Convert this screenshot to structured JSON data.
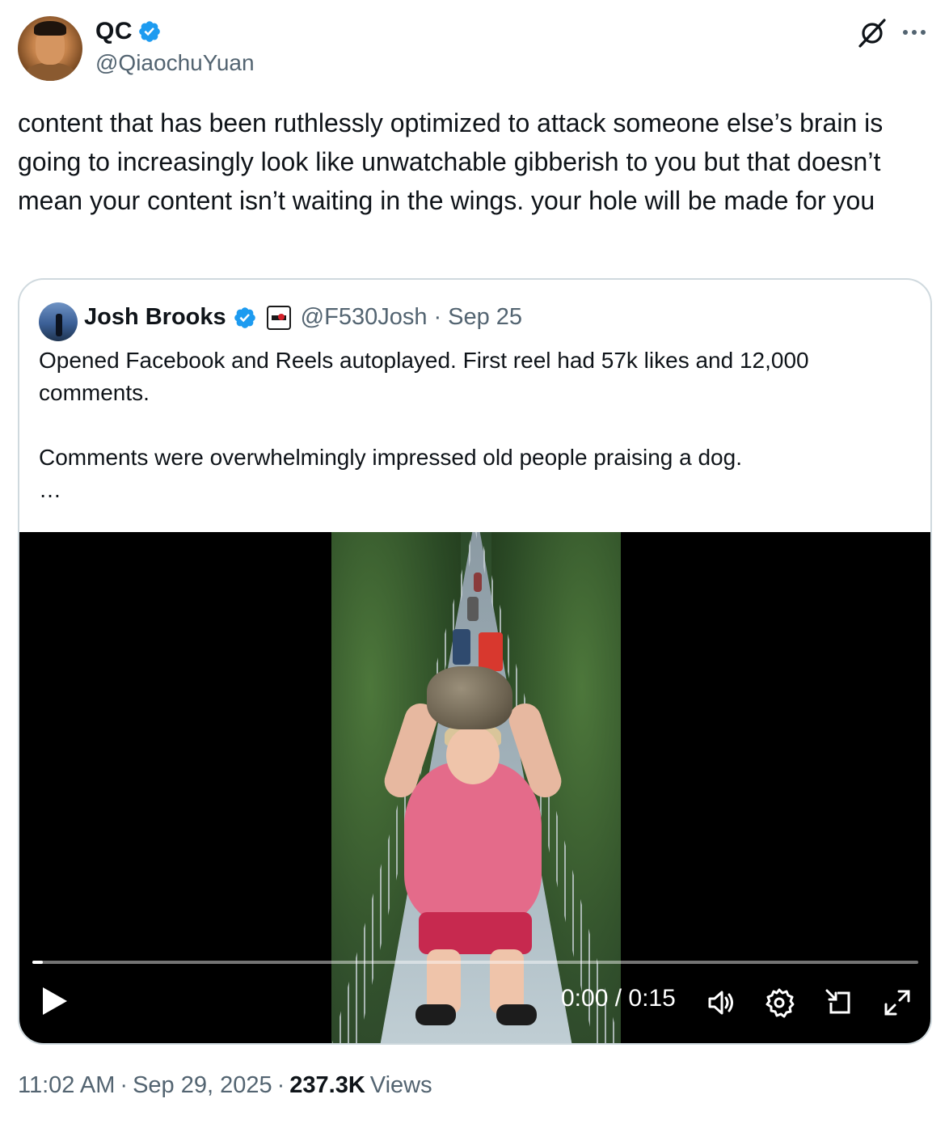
{
  "author": {
    "name": "QC",
    "handle": "@QiaochuYuan",
    "verified": true
  },
  "tweet": {
    "text": "content that has been ruthlessly optimized to attack someone else’s brain is going to increasingly look like unwatchable gibberish to you but that doesn’t mean your content isn’t waiting in the wings. your hole will be made for you"
  },
  "quote": {
    "name": "Josh Brooks",
    "handle": "@F530Josh",
    "separator": "·",
    "date": "Sep 25",
    "text": "Opened Facebook and Reels autoplayed. First reel had 57k likes and 12,000 comments.\n\nComments were overwhelmingly impressed old people praising a dog.\n…"
  },
  "video": {
    "time": "0:00 / 0:15",
    "progress": 0.01
  },
  "meta": {
    "time": "11:02 AM",
    "dot1": "·",
    "date": "Sep 29, 2025",
    "dot2": "·",
    "views_count": "237.3K",
    "views_label": "Views"
  },
  "colors": {
    "text": "#0f1419",
    "secondary": "#536471",
    "verified": "#1d9bf0",
    "border": "#cfd9de"
  }
}
